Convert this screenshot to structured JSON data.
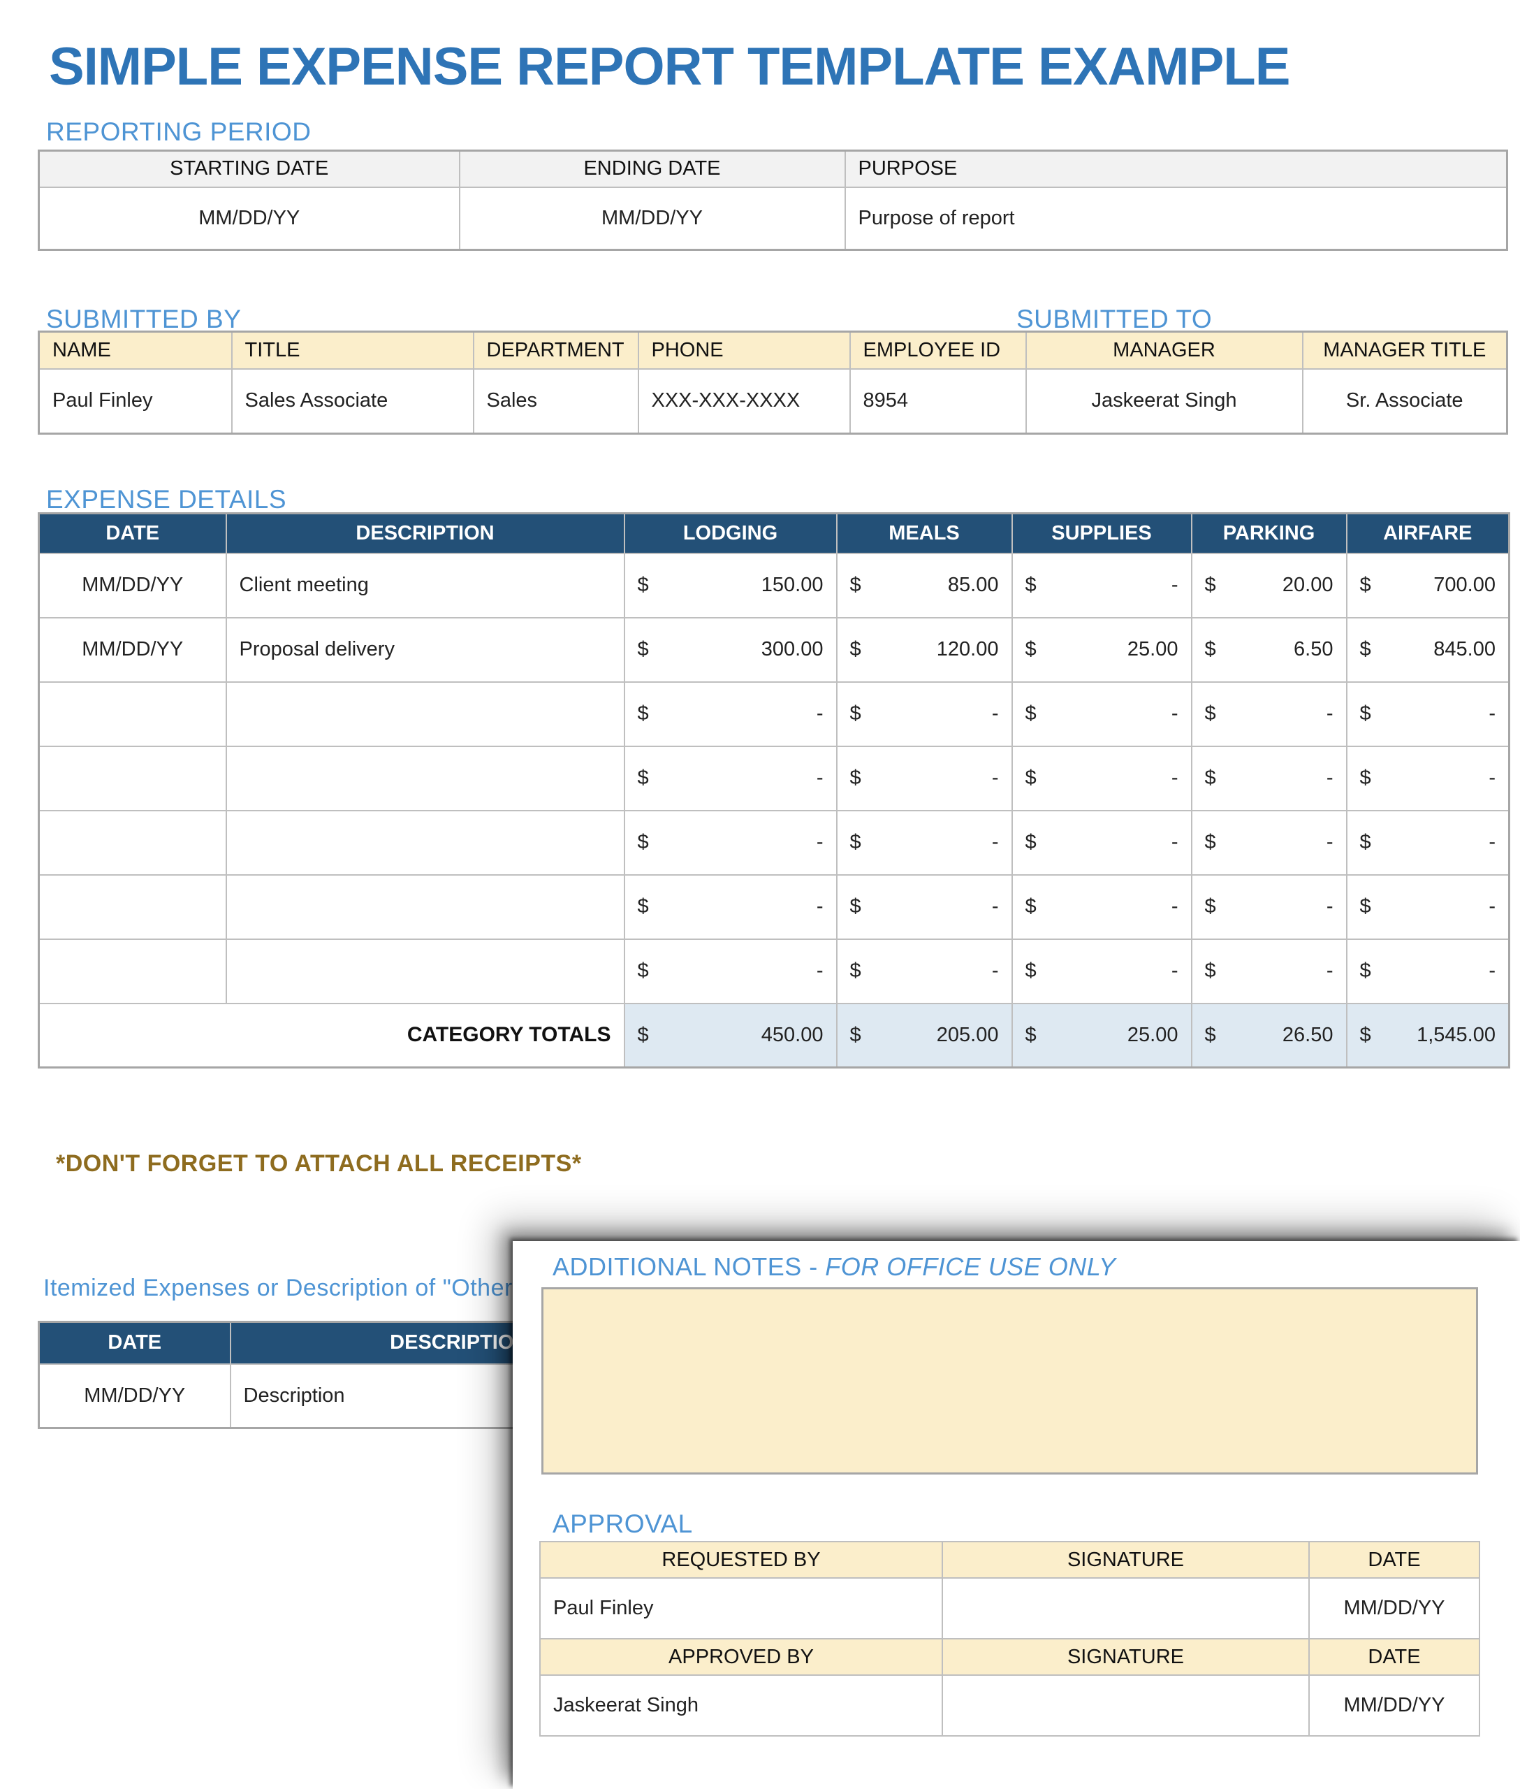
{
  "title": "SIMPLE EXPENSE REPORT TEMPLATE EXAMPLE",
  "currency": "$",
  "colors": {
    "title_blue": "#2E74B6",
    "heading_blue": "#4E94D4",
    "table_navy": "#235077",
    "header_cream": "#FBEECB",
    "totals_light_blue": "#DEE9F2",
    "header_gray": "#F2F2F2",
    "receipts_gold": "#8E6C1F"
  },
  "reporting_period": {
    "heading": "REPORTING PERIOD",
    "columns": [
      "STARTING DATE",
      "ENDING DATE",
      "PURPOSE"
    ],
    "values": [
      "MM/DD/YY",
      "MM/DD/YY",
      "Purpose of report"
    ]
  },
  "submitted": {
    "heading_by": "SUBMITTED BY",
    "heading_to": "SUBMITTED TO",
    "columns": [
      "NAME",
      "TITLE",
      "DEPARTMENT",
      "PHONE",
      "EMPLOYEE ID",
      "MANAGER",
      "MANAGER TITLE"
    ],
    "values": [
      "Paul Finley",
      "Sales Associate",
      "Sales",
      "XXX-XXX-XXXX",
      "8954",
      "Jaskeerat Singh",
      "Sr. Associate"
    ]
  },
  "expense": {
    "heading": "EXPENSE DETAILS",
    "columns": [
      "DATE",
      "DESCRIPTION",
      "LODGING",
      "MEALS",
      "SUPPLIES",
      "PARKING",
      "AIRFARE"
    ],
    "rows": [
      [
        "MM/DD/YY",
        "Client meeting",
        "150.00",
        "85.00",
        "-",
        "20.00",
        "700.00"
      ],
      [
        "MM/DD/YY",
        "Proposal delivery",
        "300.00",
        "120.00",
        "25.00",
        "6.50",
        "845.00"
      ],
      [
        "",
        "",
        "-",
        "-",
        "-",
        "-",
        "-"
      ],
      [
        "",
        "",
        "-",
        "-",
        "-",
        "-",
        "-"
      ],
      [
        "",
        "",
        "-",
        "-",
        "-",
        "-",
        "-"
      ],
      [
        "",
        "",
        "-",
        "-",
        "-",
        "-",
        "-"
      ],
      [
        "",
        "",
        "-",
        "-",
        "-",
        "-",
        "-"
      ]
    ],
    "totals_label": "CATEGORY TOTALS",
    "totals": [
      "450.00",
      "205.00",
      "25.00",
      "26.50",
      "1,545.00"
    ]
  },
  "receipts_note": "*DON'T FORGET TO ATTACH ALL RECEIPTS*",
  "itemized": {
    "heading": "Itemized Expenses or Description of \"Other\"",
    "columns": [
      "DATE",
      "DESCRIPTION"
    ],
    "values": [
      "MM/DD/YY",
      "Description"
    ]
  },
  "panel": {
    "notes_heading_main": "ADDITIONAL NOTES - ",
    "notes_heading_italic": "FOR OFFICE USE ONLY",
    "notes_value": "",
    "approval_heading": "APPROVAL",
    "approval": {
      "header1": [
        "REQUESTED BY",
        "SIGNATURE",
        "DATE"
      ],
      "row1": [
        "Paul Finley",
        "",
        "MM/DD/YY"
      ],
      "header2": [
        "APPROVED BY",
        "SIGNATURE",
        "DATE"
      ],
      "row2": [
        "Jaskeerat Singh",
        "",
        "MM/DD/YY"
      ]
    }
  }
}
